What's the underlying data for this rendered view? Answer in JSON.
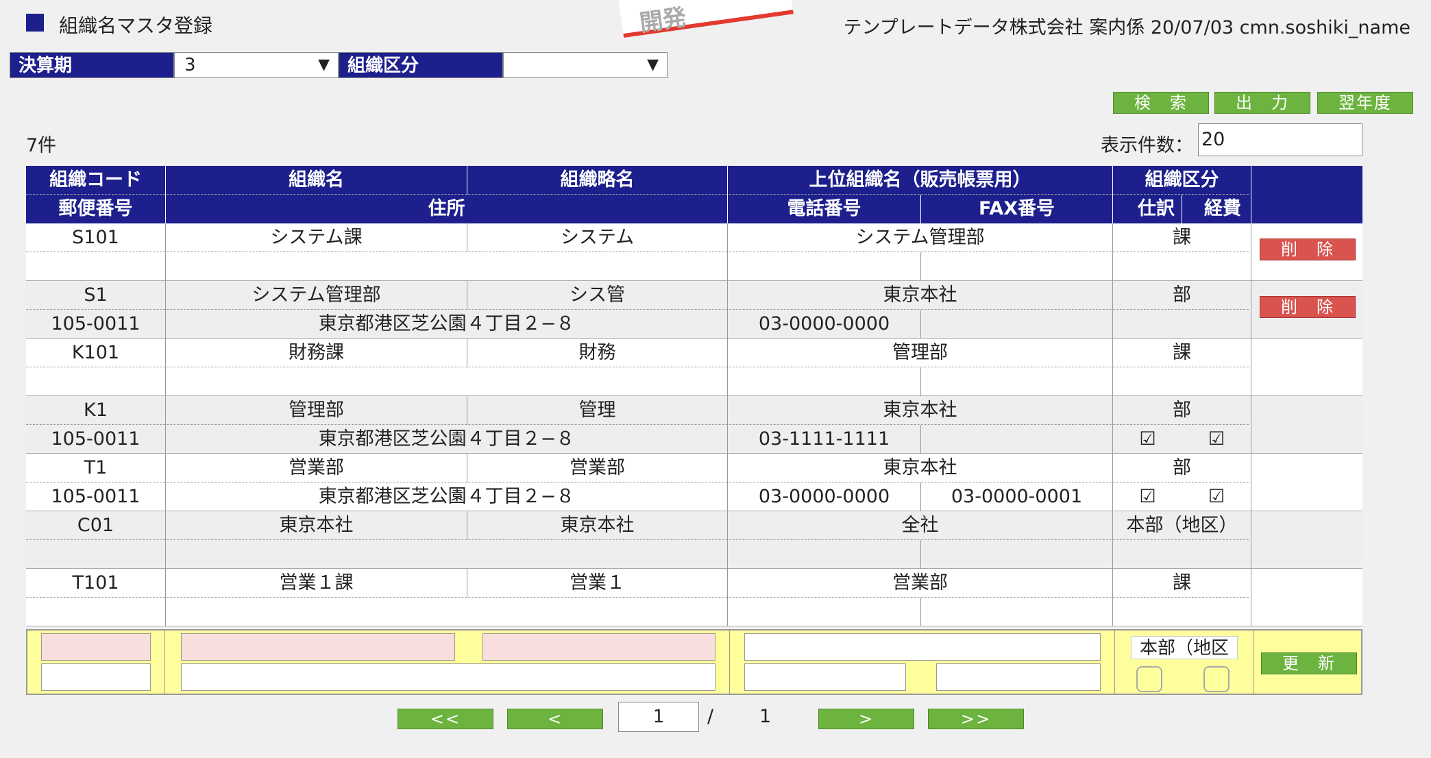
{
  "header": {
    "title": "組織名マスタ登録",
    "stamp": "開発",
    "right": "テンプレートデータ株式会社 案内係 20/07/03 cmn.soshiki_name"
  },
  "filters": {
    "period_label": "決算期",
    "period_value": "3",
    "division_label": "組織区分",
    "division_value": ""
  },
  "buttons": {
    "search": "検　索",
    "output": "出　力",
    "next_year": "翌年度",
    "delete": "削　除",
    "update": "更　新"
  },
  "count_text": "7件",
  "display_count": {
    "label": "表示件数：",
    "value": "20"
  },
  "columns": {
    "org_code": "組織コード",
    "org_name": "組織名",
    "org_short": "組織略名",
    "parent_name": "上位組織名（販売帳票用）",
    "division": "組織区分",
    "postal": "郵便番号",
    "address": "住所",
    "phone": "電話番号",
    "fax": "FAX番号",
    "journal": "仕訳",
    "expense": "経費"
  },
  "rows": [
    {
      "code": "S101",
      "name": "システム課",
      "short": "システム",
      "parent": "システム管理部",
      "division": "課",
      "postal": "",
      "address": "",
      "phone": "",
      "fax": "",
      "journal": "",
      "expense": "",
      "deletable": true
    },
    {
      "code": "S1",
      "name": "システム管理部",
      "short": "シス管",
      "parent": "東京本社",
      "division": "部",
      "postal": "105-0011",
      "address": "東京都港区芝公園４丁目２−８",
      "phone": "03-0000-0000",
      "fax": "",
      "journal": "",
      "expense": "",
      "deletable": true
    },
    {
      "code": "K101",
      "name": "財務課",
      "short": "財務",
      "parent": "管理部",
      "division": "課",
      "postal": "",
      "address": "",
      "phone": "",
      "fax": "",
      "journal": "",
      "expense": "",
      "deletable": false
    },
    {
      "code": "K1",
      "name": "管理部",
      "short": "管理",
      "parent": "東京本社",
      "division": "部",
      "postal": "105-0011",
      "address": "東京都港区芝公園４丁目２−８",
      "phone": "03-1111-1111",
      "fax": "",
      "journal": "☑",
      "expense": "☑",
      "deletable": false
    },
    {
      "code": "T1",
      "name": "営業部",
      "short": "営業部",
      "parent": "東京本社",
      "division": "部",
      "postal": "105-0011",
      "address": "東京都港区芝公園４丁目２−８",
      "phone": "03-0000-0000",
      "fax": "03-0000-0001",
      "journal": "☑",
      "expense": "☑",
      "deletable": false
    },
    {
      "code": "C01",
      "name": "東京本社",
      "short": "東京本社",
      "parent": "全社",
      "division": "本部（地区）",
      "postal": "",
      "address": "",
      "phone": "",
      "fax": "",
      "journal": "",
      "expense": "",
      "deletable": false
    },
    {
      "code": "T101",
      "name": "営業１課",
      "short": "営業１",
      "parent": "営業部",
      "division": "課",
      "postal": "",
      "address": "",
      "phone": "",
      "fax": "",
      "journal": "",
      "expense": "",
      "deletable": false
    }
  ],
  "edit_row": {
    "division_value": "本部（地区"
  },
  "pager": {
    "first": "<<",
    "prev": "<",
    "page": "1",
    "sep": "/",
    "total": "1",
    "next": ">",
    "last": ">>"
  }
}
